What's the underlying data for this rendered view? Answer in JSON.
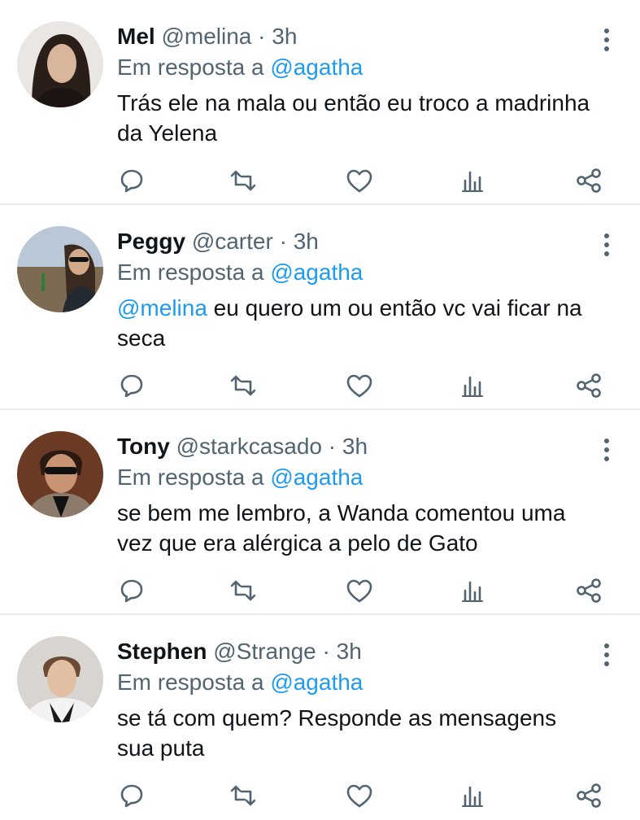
{
  "colors": {
    "accent": "#1d9bf0",
    "muted": "#536471",
    "text": "#0f1419",
    "divider": "#e6ecf0"
  },
  "tweets": [
    {
      "name": "Mel",
      "handle": "@melina",
      "dot": "·",
      "time": "3h",
      "reply_prefix": "Em resposta a",
      "reply_to": "@agatha",
      "mention": "",
      "text": "Trás ele na mala ou então eu troco a madrinha da Yelena",
      "icons": [
        "reply-icon",
        "retweet-icon",
        "like-icon",
        "analytics-icon",
        "share-icon"
      ]
    },
    {
      "name": "Peggy",
      "handle": "@carter",
      "dot": "·",
      "time": "3h",
      "reply_prefix": "Em resposta a",
      "reply_to": "@agatha",
      "mention": "@melina",
      "text": " eu quero um ou então vc vai ficar na seca",
      "icons": [
        "reply-icon",
        "retweet-icon",
        "like-icon",
        "analytics-icon",
        "share-icon"
      ]
    },
    {
      "name": "Tony",
      "handle": "@starkcasado",
      "dot": "·",
      "time": "3h",
      "reply_prefix": "Em resposta a",
      "reply_to": "@agatha",
      "mention": "",
      "text": "se bem me lembro, a Wanda comentou uma vez que era alérgica a pelo de Gato",
      "icons": [
        "reply-icon",
        "retweet-icon",
        "like-icon",
        "analytics-icon",
        "share-icon"
      ]
    },
    {
      "name": "Stephen",
      "handle": "@Strange",
      "dot": "·",
      "time": "3h",
      "reply_prefix": "Em resposta a",
      "reply_to": "@agatha",
      "mention": "",
      "text": "se tá com quem? Responde as mensagens sua puta",
      "icons": [
        "reply-icon",
        "retweet-icon",
        "like-icon",
        "analytics-icon",
        "share-icon"
      ]
    }
  ]
}
